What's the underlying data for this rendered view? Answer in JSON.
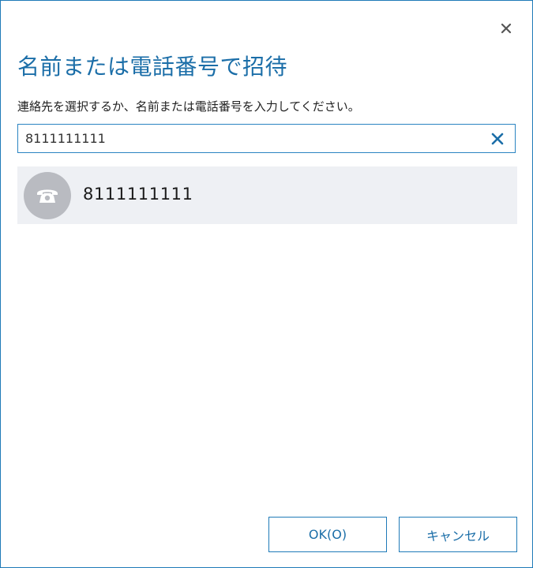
{
  "dialog": {
    "title": "名前または電話番号で招待",
    "instruction": "連絡先を選択するか、名前または電話番号を入力してください。",
    "close_icon": "close-icon"
  },
  "search": {
    "value": "8111111111",
    "clear_icon": "clear-icon"
  },
  "results": [
    {
      "label": "8111111111",
      "avatar_icon": "phone-icon"
    }
  ],
  "buttons": {
    "ok_label": "OK(O)",
    "cancel_label": "キャンセル"
  },
  "colors": {
    "accent": "#1b6ea8",
    "border": "#1f7ab8",
    "result_bg": "#eef0f4",
    "avatar_bg": "#b9bbc1"
  }
}
